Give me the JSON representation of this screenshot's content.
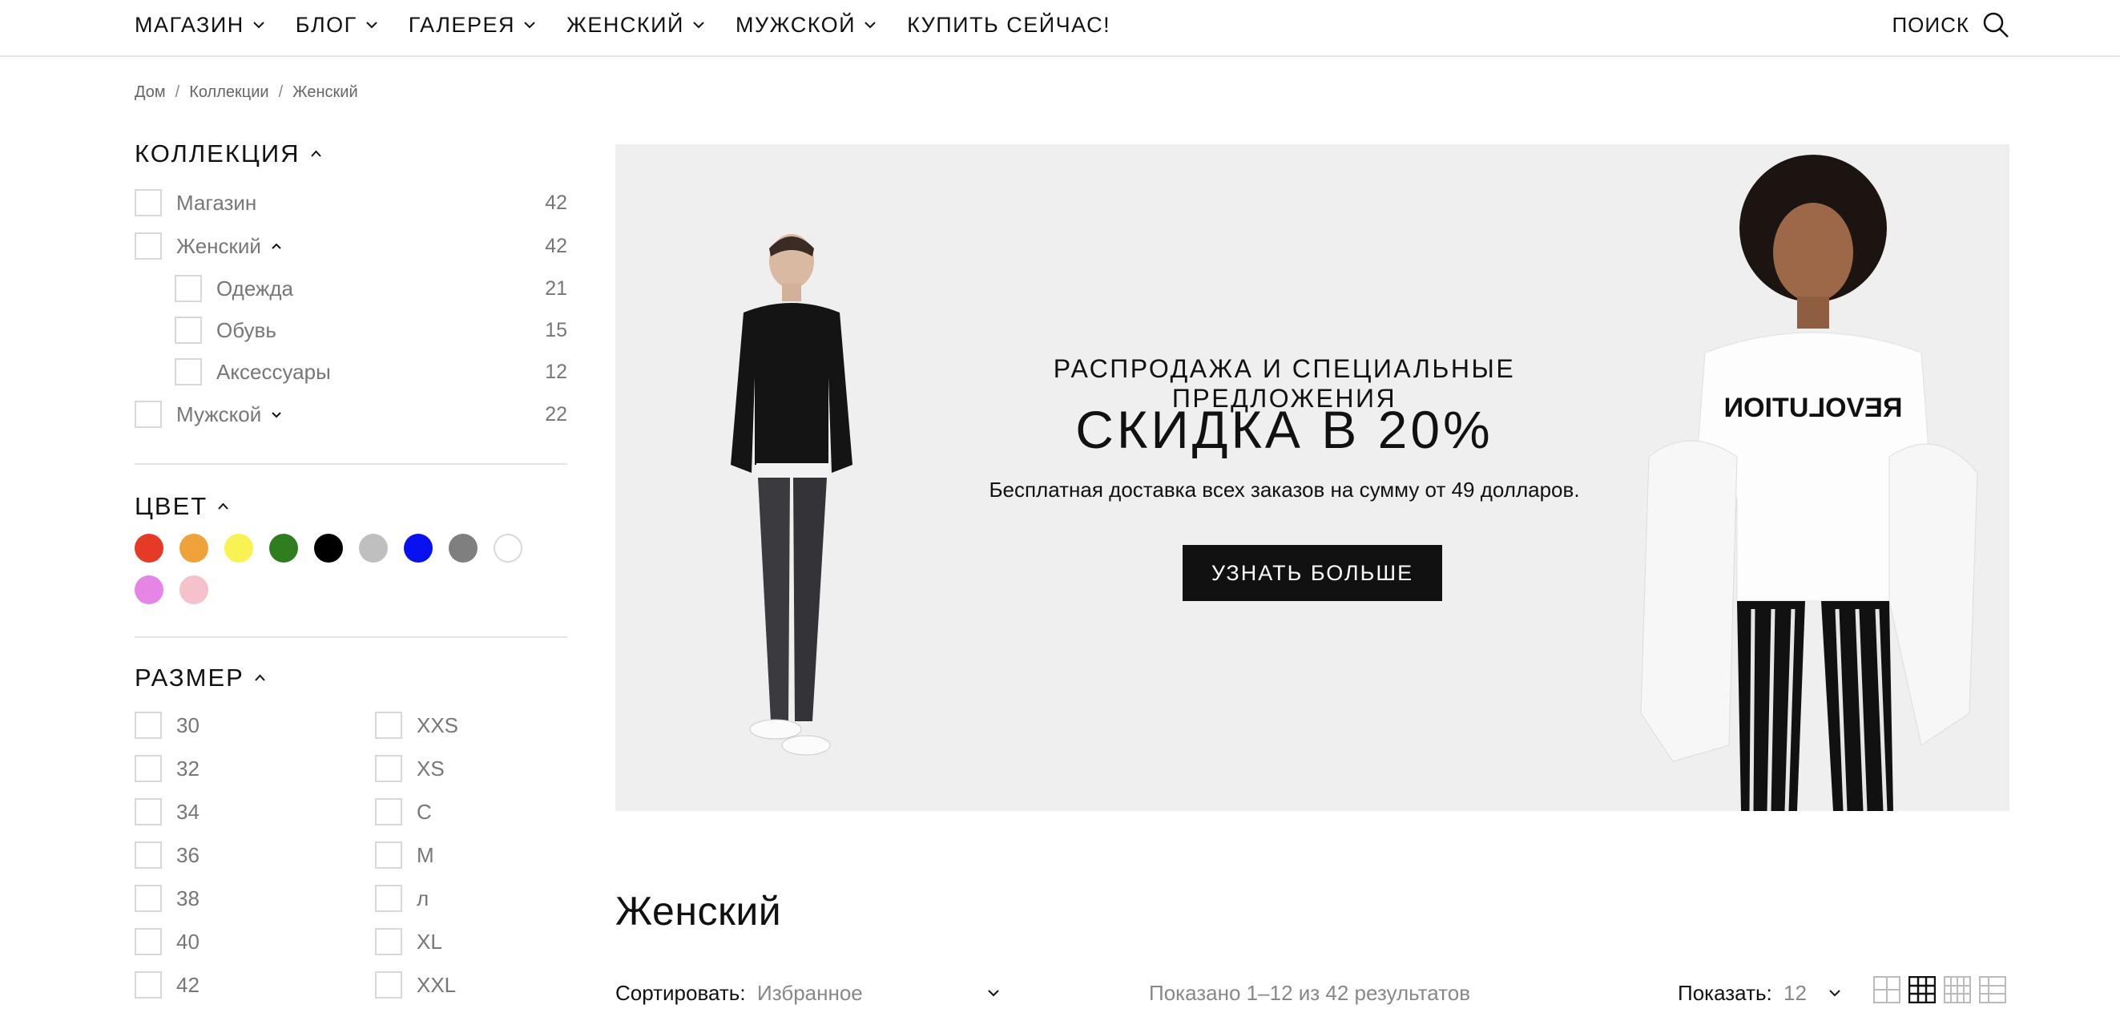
{
  "nav": {
    "items": [
      {
        "label": "МАГАЗИН"
      },
      {
        "label": "БЛОГ"
      },
      {
        "label": "ГАЛЕРЕЯ"
      },
      {
        "label": "ЖЕНСКИЙ"
      },
      {
        "label": "МУЖСКОЙ"
      },
      {
        "label": "КУПИТЬ СЕЙЧАС!"
      }
    ],
    "search_label": "ПОИСК"
  },
  "breadcrumb": [
    "Дом",
    "Коллекции",
    "Женский"
  ],
  "filters": {
    "collection": {
      "title": "КОЛЛЕКЦИЯ",
      "items": [
        {
          "label": "Магазин",
          "count": "42"
        },
        {
          "label": "Женский",
          "count": "42"
        },
        {
          "label": "Одежда",
          "count": "21"
        },
        {
          "label": "Обувь",
          "count": "15"
        },
        {
          "label": "Аксессуары",
          "count": "12"
        },
        {
          "label": "Мужской",
          "count": "22"
        }
      ]
    },
    "color": {
      "title": "ЦВЕТ",
      "swatches": [
        "#e53a26",
        "#f0a23a",
        "#f8f352",
        "#2e7d1f",
        "#000000",
        "#bfbfbf",
        "#0a11f0",
        "#7f7f7f",
        "#ffffff",
        "#e585e6",
        "#f5c1cb"
      ]
    },
    "size": {
      "title": "РАЗМЕР",
      "left": [
        "30",
        "32",
        "34",
        "36",
        "38",
        "40",
        "42"
      ],
      "right": [
        "XXS",
        "XS",
        "С",
        "M",
        "л",
        "XL",
        "XXL"
      ]
    }
  },
  "banner": {
    "subtitle": "РАСПРОДАЖА И СПЕЦИАЛЬНЫЕ ПРЕДЛОЖЕНИЯ",
    "headline": "СКИДКА В 20%",
    "description": "Бесплатная доставка всех заказов на сумму от 49 долларов.",
    "cta": "УЗНАТЬ БОЛЬШЕ",
    "shirt_print": "REVOLUTION"
  },
  "listing": {
    "title": "Женский",
    "sort_label": "Сортировать:",
    "sort_value": "Избранное",
    "results_text": "Показано 1–12 из 42 результатов",
    "show_label": "Показать:",
    "show_value": "12"
  }
}
